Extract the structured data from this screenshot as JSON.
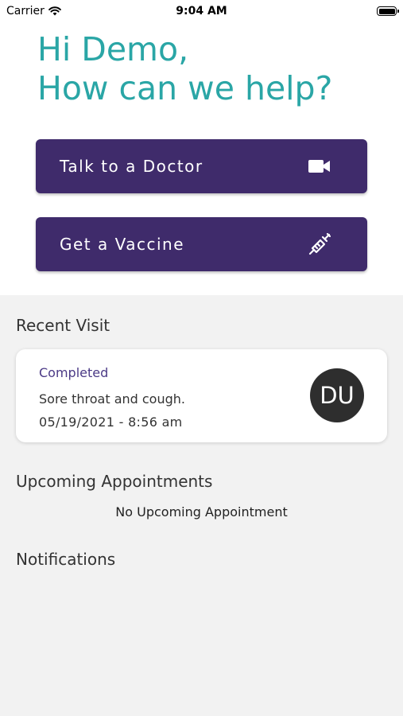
{
  "status_bar": {
    "carrier": "Carrier",
    "time": "9:04 AM"
  },
  "greeting": {
    "line1": "Hi Demo,",
    "line2": "How can we help?",
    "color": "#2aa6a6"
  },
  "actions": {
    "talk_to_doctor": {
      "label": "Talk to a Doctor",
      "icon": "video-camera-icon"
    },
    "get_vaccine": {
      "label": "Get a Vaccine",
      "icon": "syringe-icon"
    },
    "button_color": "#3f2b6b"
  },
  "recent_visit": {
    "title": "Recent Visit",
    "status": "Completed",
    "reason": "Sore throat and cough.",
    "datetime": "05/19/2021 - 8:56 am",
    "avatar_initials": "DU"
  },
  "upcoming": {
    "title": "Upcoming Appointments",
    "empty_message": "No Upcoming Appointment"
  },
  "notifications": {
    "title": "Notifications"
  }
}
